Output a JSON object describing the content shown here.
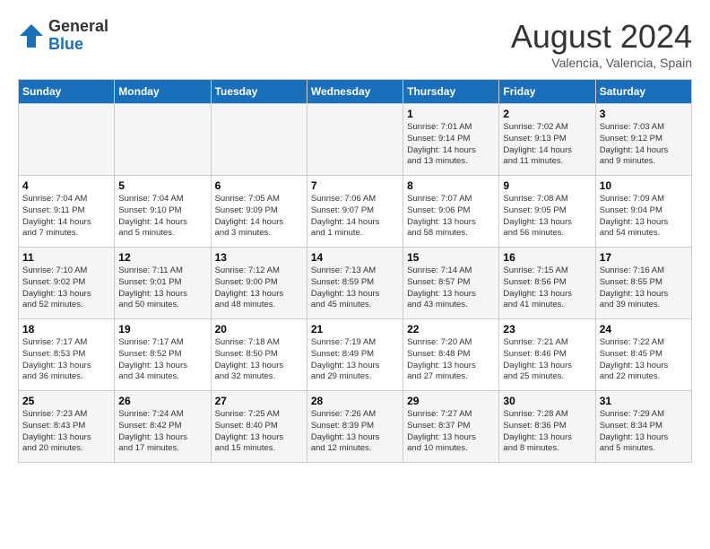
{
  "logo": {
    "general": "General",
    "blue": "Blue"
  },
  "title": {
    "month_year": "August 2024",
    "location": "Valencia, Valencia, Spain"
  },
  "days_of_week": [
    "Sunday",
    "Monday",
    "Tuesday",
    "Wednesday",
    "Thursday",
    "Friday",
    "Saturday"
  ],
  "weeks": [
    [
      {
        "day": "",
        "info": ""
      },
      {
        "day": "",
        "info": ""
      },
      {
        "day": "",
        "info": ""
      },
      {
        "day": "",
        "info": ""
      },
      {
        "day": "1",
        "info": "Sunrise: 7:01 AM\nSunset: 9:14 PM\nDaylight: 14 hours\nand 13 minutes."
      },
      {
        "day": "2",
        "info": "Sunrise: 7:02 AM\nSunset: 9:13 PM\nDaylight: 14 hours\nand 11 minutes."
      },
      {
        "day": "3",
        "info": "Sunrise: 7:03 AM\nSunset: 9:12 PM\nDaylight: 14 hours\nand 9 minutes."
      }
    ],
    [
      {
        "day": "4",
        "info": "Sunrise: 7:04 AM\nSunset: 9:11 PM\nDaylight: 14 hours\nand 7 minutes."
      },
      {
        "day": "5",
        "info": "Sunrise: 7:04 AM\nSunset: 9:10 PM\nDaylight: 14 hours\nand 5 minutes."
      },
      {
        "day": "6",
        "info": "Sunrise: 7:05 AM\nSunset: 9:09 PM\nDaylight: 14 hours\nand 3 minutes."
      },
      {
        "day": "7",
        "info": "Sunrise: 7:06 AM\nSunset: 9:07 PM\nDaylight: 14 hours\nand 1 minute."
      },
      {
        "day": "8",
        "info": "Sunrise: 7:07 AM\nSunset: 9:06 PM\nDaylight: 13 hours\nand 58 minutes."
      },
      {
        "day": "9",
        "info": "Sunrise: 7:08 AM\nSunset: 9:05 PM\nDaylight: 13 hours\nand 56 minutes."
      },
      {
        "day": "10",
        "info": "Sunrise: 7:09 AM\nSunset: 9:04 PM\nDaylight: 13 hours\nand 54 minutes."
      }
    ],
    [
      {
        "day": "11",
        "info": "Sunrise: 7:10 AM\nSunset: 9:02 PM\nDaylight: 13 hours\nand 52 minutes."
      },
      {
        "day": "12",
        "info": "Sunrise: 7:11 AM\nSunset: 9:01 PM\nDaylight: 13 hours\nand 50 minutes."
      },
      {
        "day": "13",
        "info": "Sunrise: 7:12 AM\nSunset: 9:00 PM\nDaylight: 13 hours\nand 48 minutes."
      },
      {
        "day": "14",
        "info": "Sunrise: 7:13 AM\nSunset: 8:59 PM\nDaylight: 13 hours\nand 45 minutes."
      },
      {
        "day": "15",
        "info": "Sunrise: 7:14 AM\nSunset: 8:57 PM\nDaylight: 13 hours\nand 43 minutes."
      },
      {
        "day": "16",
        "info": "Sunrise: 7:15 AM\nSunset: 8:56 PM\nDaylight: 13 hours\nand 41 minutes."
      },
      {
        "day": "17",
        "info": "Sunrise: 7:16 AM\nSunset: 8:55 PM\nDaylight: 13 hours\nand 39 minutes."
      }
    ],
    [
      {
        "day": "18",
        "info": "Sunrise: 7:17 AM\nSunset: 8:53 PM\nDaylight: 13 hours\nand 36 minutes."
      },
      {
        "day": "19",
        "info": "Sunrise: 7:17 AM\nSunset: 8:52 PM\nDaylight: 13 hours\nand 34 minutes."
      },
      {
        "day": "20",
        "info": "Sunrise: 7:18 AM\nSunset: 8:50 PM\nDaylight: 13 hours\nand 32 minutes."
      },
      {
        "day": "21",
        "info": "Sunrise: 7:19 AM\nSunset: 8:49 PM\nDaylight: 13 hours\nand 29 minutes."
      },
      {
        "day": "22",
        "info": "Sunrise: 7:20 AM\nSunset: 8:48 PM\nDaylight: 13 hours\nand 27 minutes."
      },
      {
        "day": "23",
        "info": "Sunrise: 7:21 AM\nSunset: 8:46 PM\nDaylight: 13 hours\nand 25 minutes."
      },
      {
        "day": "24",
        "info": "Sunrise: 7:22 AM\nSunset: 8:45 PM\nDaylight: 13 hours\nand 22 minutes."
      }
    ],
    [
      {
        "day": "25",
        "info": "Sunrise: 7:23 AM\nSunset: 8:43 PM\nDaylight: 13 hours\nand 20 minutes."
      },
      {
        "day": "26",
        "info": "Sunrise: 7:24 AM\nSunset: 8:42 PM\nDaylight: 13 hours\nand 17 minutes."
      },
      {
        "day": "27",
        "info": "Sunrise: 7:25 AM\nSunset: 8:40 PM\nDaylight: 13 hours\nand 15 minutes."
      },
      {
        "day": "28",
        "info": "Sunrise: 7:26 AM\nSunset: 8:39 PM\nDaylight: 13 hours\nand 12 minutes."
      },
      {
        "day": "29",
        "info": "Sunrise: 7:27 AM\nSunset: 8:37 PM\nDaylight: 13 hours\nand 10 minutes."
      },
      {
        "day": "30",
        "info": "Sunrise: 7:28 AM\nSunset: 8:36 PM\nDaylight: 13 hours\nand 8 minutes."
      },
      {
        "day": "31",
        "info": "Sunrise: 7:29 AM\nSunset: 8:34 PM\nDaylight: 13 hours\nand 5 minutes."
      }
    ]
  ]
}
